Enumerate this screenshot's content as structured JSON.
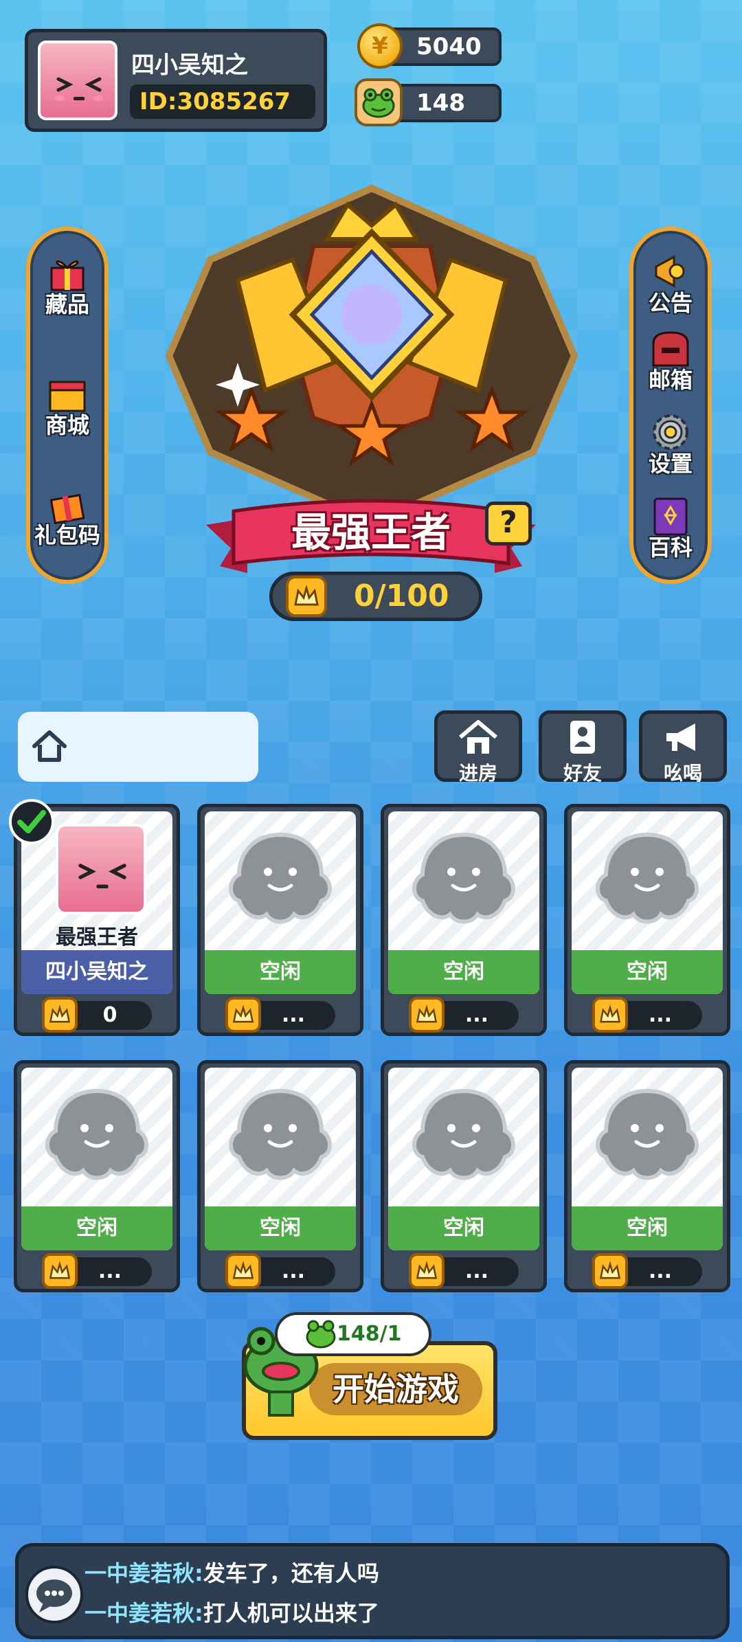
{
  "profile": {
    "nickname": "四小吴知之",
    "id_text": "ID:3085267"
  },
  "currency": {
    "coins": "5040",
    "frogs": "148"
  },
  "left_menu": [
    {
      "label": "藏品",
      "icon": "gift-collection-icon"
    },
    {
      "label": "商城",
      "icon": "shop-icon"
    },
    {
      "label": "礼包码",
      "icon": "gift-code-icon"
    }
  ],
  "right_menu": [
    {
      "label": "公告",
      "icon": "announcement-horn-icon"
    },
    {
      "label": "邮箱",
      "icon": "mailbox-icon"
    },
    {
      "label": "设置",
      "icon": "gear-icon"
    },
    {
      "label": "百科",
      "icon": "encyclopedia-book-icon"
    }
  ],
  "rank": {
    "title": "最强王者",
    "help": "?",
    "progress_text": "0/100",
    "stars": 3
  },
  "toolbar": {
    "join_room": "进房",
    "friends": "好友",
    "shout": "吆喝"
  },
  "slots": [
    {
      "status": "四小吴知之",
      "rank": "最强王者",
      "score": "0",
      "is_me": true
    },
    {
      "status": "空闲",
      "score": "...",
      "is_me": false
    },
    {
      "status": "空闲",
      "score": "...",
      "is_me": false
    },
    {
      "status": "空闲",
      "score": "...",
      "is_me": false
    },
    {
      "status": "空闲",
      "score": "...",
      "is_me": false
    },
    {
      "status": "空闲",
      "score": "...",
      "is_me": false
    },
    {
      "status": "空闲",
      "score": "...",
      "is_me": false
    },
    {
      "status": "空闲",
      "score": "...",
      "is_me": false
    }
  ],
  "start": {
    "label": "开始游戏",
    "cost": "148/1"
  },
  "chat": [
    {
      "name": "一中姜若秋:",
      "text": "发车了，还有人吗"
    },
    {
      "name": "一中姜若秋:",
      "text": "打人机可以出来了"
    }
  ],
  "colors": {
    "gold": "#ffd23a",
    "panel": "#3c4a5a",
    "green": "#4fae49",
    "ribbon": "#e8355e"
  }
}
